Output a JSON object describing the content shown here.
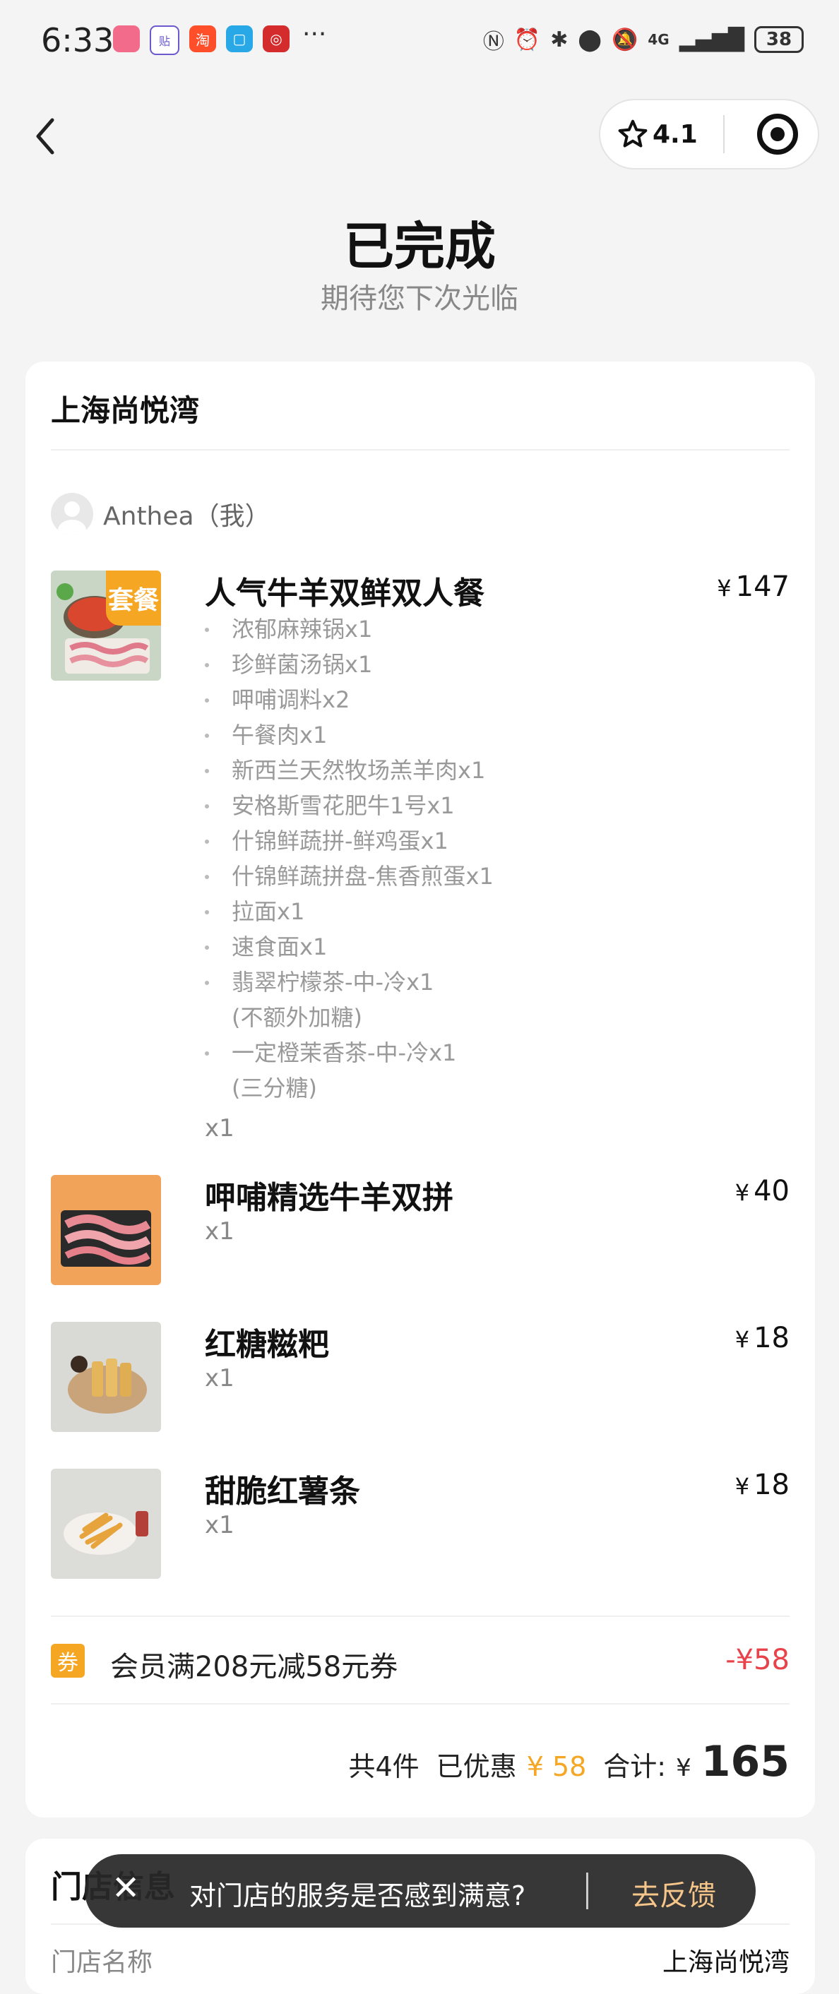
{
  "status_bar": {
    "time": "6:33",
    "dots": "···",
    "network": "4G",
    "battery": "38"
  },
  "nav": {
    "rating": "4.1"
  },
  "header": {
    "title": "已完成",
    "subtitle": "期待您下次光临"
  },
  "order": {
    "shop_name": "上海尚悦湾",
    "user": "Anthea（我）",
    "currency": "¥",
    "items": [
      {
        "name": "人气牛羊双鲜双人餐",
        "price": "147",
        "qty": "x1",
        "tag": "套餐",
        "subs": [
          "浓郁麻辣锅x1",
          "珍鲜菌汤锅x1",
          "呷哺调料x2",
          "午餐肉x1",
          "新西兰天然牧场羔羊肉x1",
          "安格斯雪花肥牛1号x1",
          "什锦鲜蔬拼-鲜鸡蛋x1",
          "什锦鲜蔬拼盘-焦香煎蛋x1",
          "拉面x1",
          "速食面x1",
          "翡翠柠檬茶-中-冷x1",
          "(不额外加糖)",
          "一定橙茉香茶-中-冷x1",
          "(三分糖)"
        ]
      },
      {
        "name": "呷哺精选牛羊双拼",
        "price": "40",
        "qty": "x1"
      },
      {
        "name": "红糖糍粑",
        "price": "18",
        "qty": "x1"
      },
      {
        "name": "甜脆红薯条",
        "price": "18",
        "qty": "x1"
      }
    ],
    "coupon": {
      "badge": "券",
      "label": "会员满208元减58元券",
      "amount": "-¥58"
    },
    "summary": {
      "count": "共4件",
      "discount_label": "已优惠",
      "discount": "¥ 58",
      "total_label": "合计:",
      "total_currency": "¥",
      "total": "165"
    }
  },
  "store_info": {
    "title": "门店信息",
    "name_label": "门店名称",
    "name_value": "上海尚悦湾"
  },
  "toast": {
    "text": "对门店的服务是否感到满意?",
    "action": "去反馈"
  },
  "colors": {
    "accent": "#f5a623",
    "discount_red": "#e8434b"
  }
}
